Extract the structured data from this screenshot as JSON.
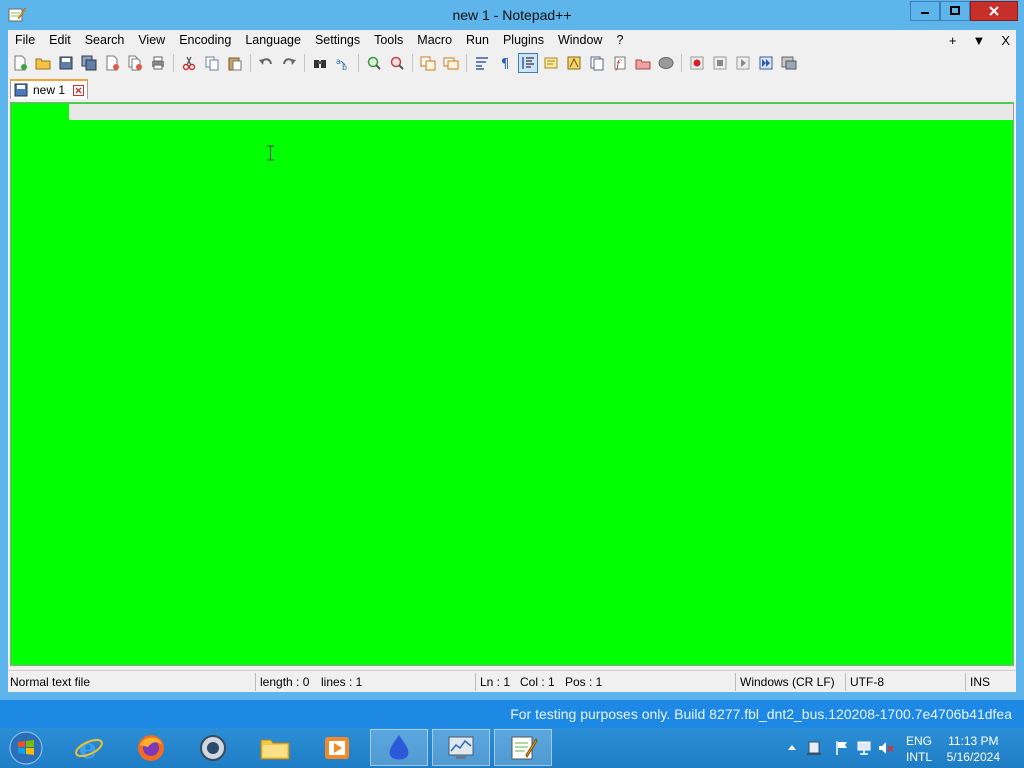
{
  "window": {
    "title": "new 1 - Notepad++"
  },
  "menu": {
    "items": [
      "File",
      "Edit",
      "Search",
      "View",
      "Encoding",
      "Language",
      "Settings",
      "Tools",
      "Macro",
      "Run",
      "Plugins",
      "Window",
      "?"
    ],
    "right": [
      "+",
      "▼",
      "X"
    ]
  },
  "tab": {
    "label": "new 1"
  },
  "status": {
    "filetype": "Normal text file",
    "length": "length : 0",
    "lines": "lines : 1",
    "ln": "Ln : 1",
    "col": "Col : 1",
    "pos": "Pos : 1",
    "eol": "Windows (CR LF)",
    "encoding": "UTF-8",
    "mode": "INS"
  },
  "desktop": {
    "watermark": "For testing purposes only. Build 8277.fbl_dnt2_bus.120208-1700.7e4706b41dfea"
  },
  "tray": {
    "lang1": "ENG",
    "lang2": "INTL",
    "time": "11:13 PM",
    "date": "5/16/2024"
  },
  "colors": {
    "editor_bg": "#00ff00",
    "titlebar": "#5db5ec",
    "close": "#c7302a",
    "taskbar": "#1f7dc4"
  }
}
